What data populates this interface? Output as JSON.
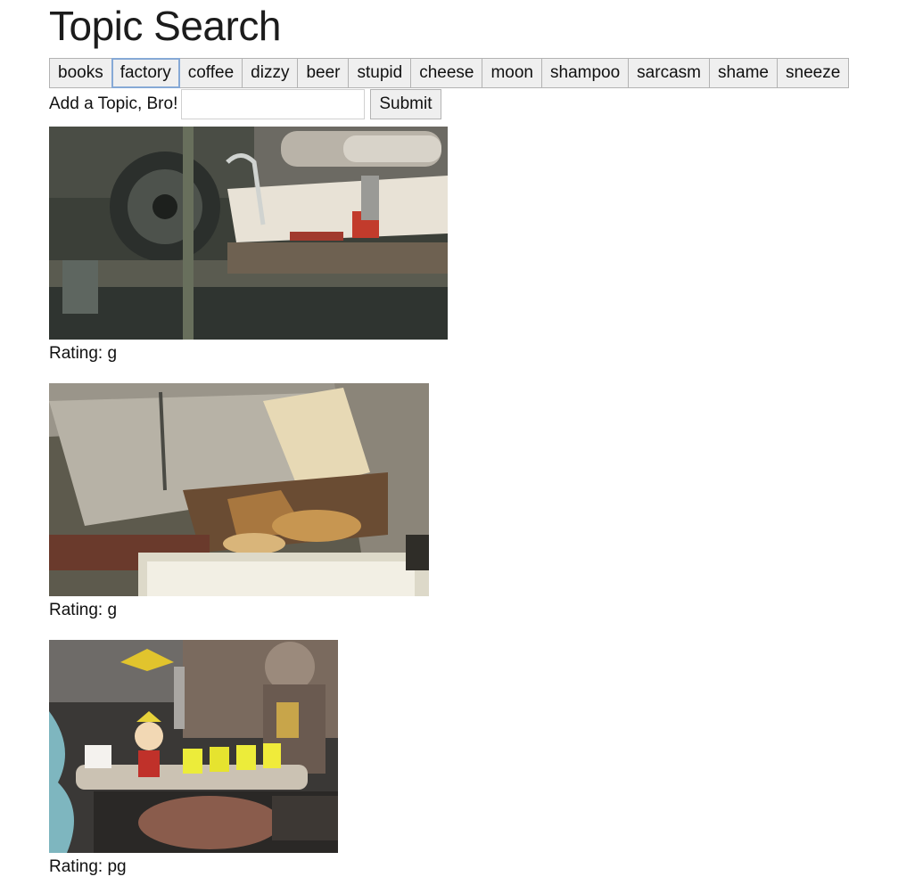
{
  "page": {
    "title": "Topic Search"
  },
  "topics": [
    "books",
    "factory",
    "coffee",
    "dizzy",
    "beer",
    "stupid",
    "cheese",
    "moon",
    "shampoo",
    "sarcasm",
    "shame",
    "sneeze"
  ],
  "add_topic": {
    "label": "Add a Topic, Bro!",
    "value": "",
    "submit_label": "Submit"
  },
  "results": [
    {
      "rating": "Rating: g",
      "description": "factory machinery rollers with paper"
    },
    {
      "rating": "Rating: g",
      "description": "potato chips falling in factory machine"
    },
    {
      "rating": "Rating: pg",
      "description": "cartoon boy on factory conveyor with jars"
    }
  ]
}
